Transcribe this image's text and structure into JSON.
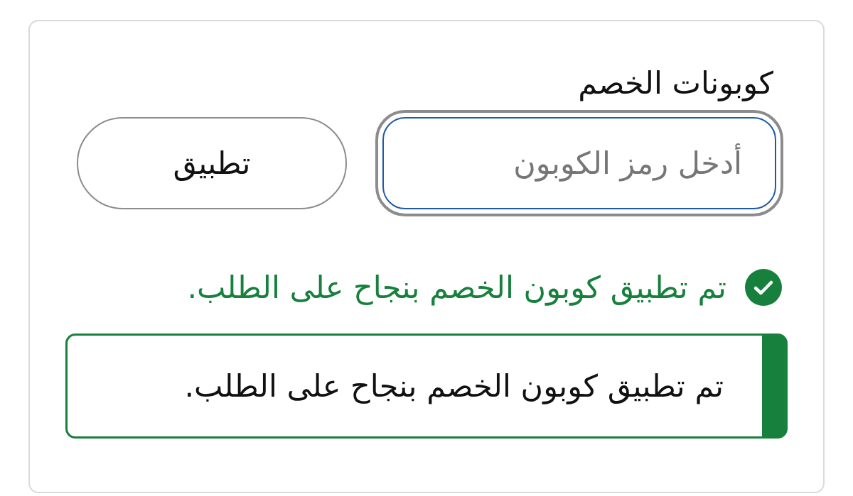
{
  "card": {
    "title": "كوبونات الخصم",
    "coupon_field": {
      "placeholder": "أدخل رمز الكوبون",
      "focused": true
    },
    "apply_button": {
      "label": "تطبيق"
    },
    "status_message": {
      "kind": "success",
      "text": "تم تطبيق كوبون الخصم بنجاح على الطلب."
    },
    "alert": {
      "kind": "success",
      "text": "تم تطبيق كوبون الخصم بنجاح على الطلب."
    }
  }
}
